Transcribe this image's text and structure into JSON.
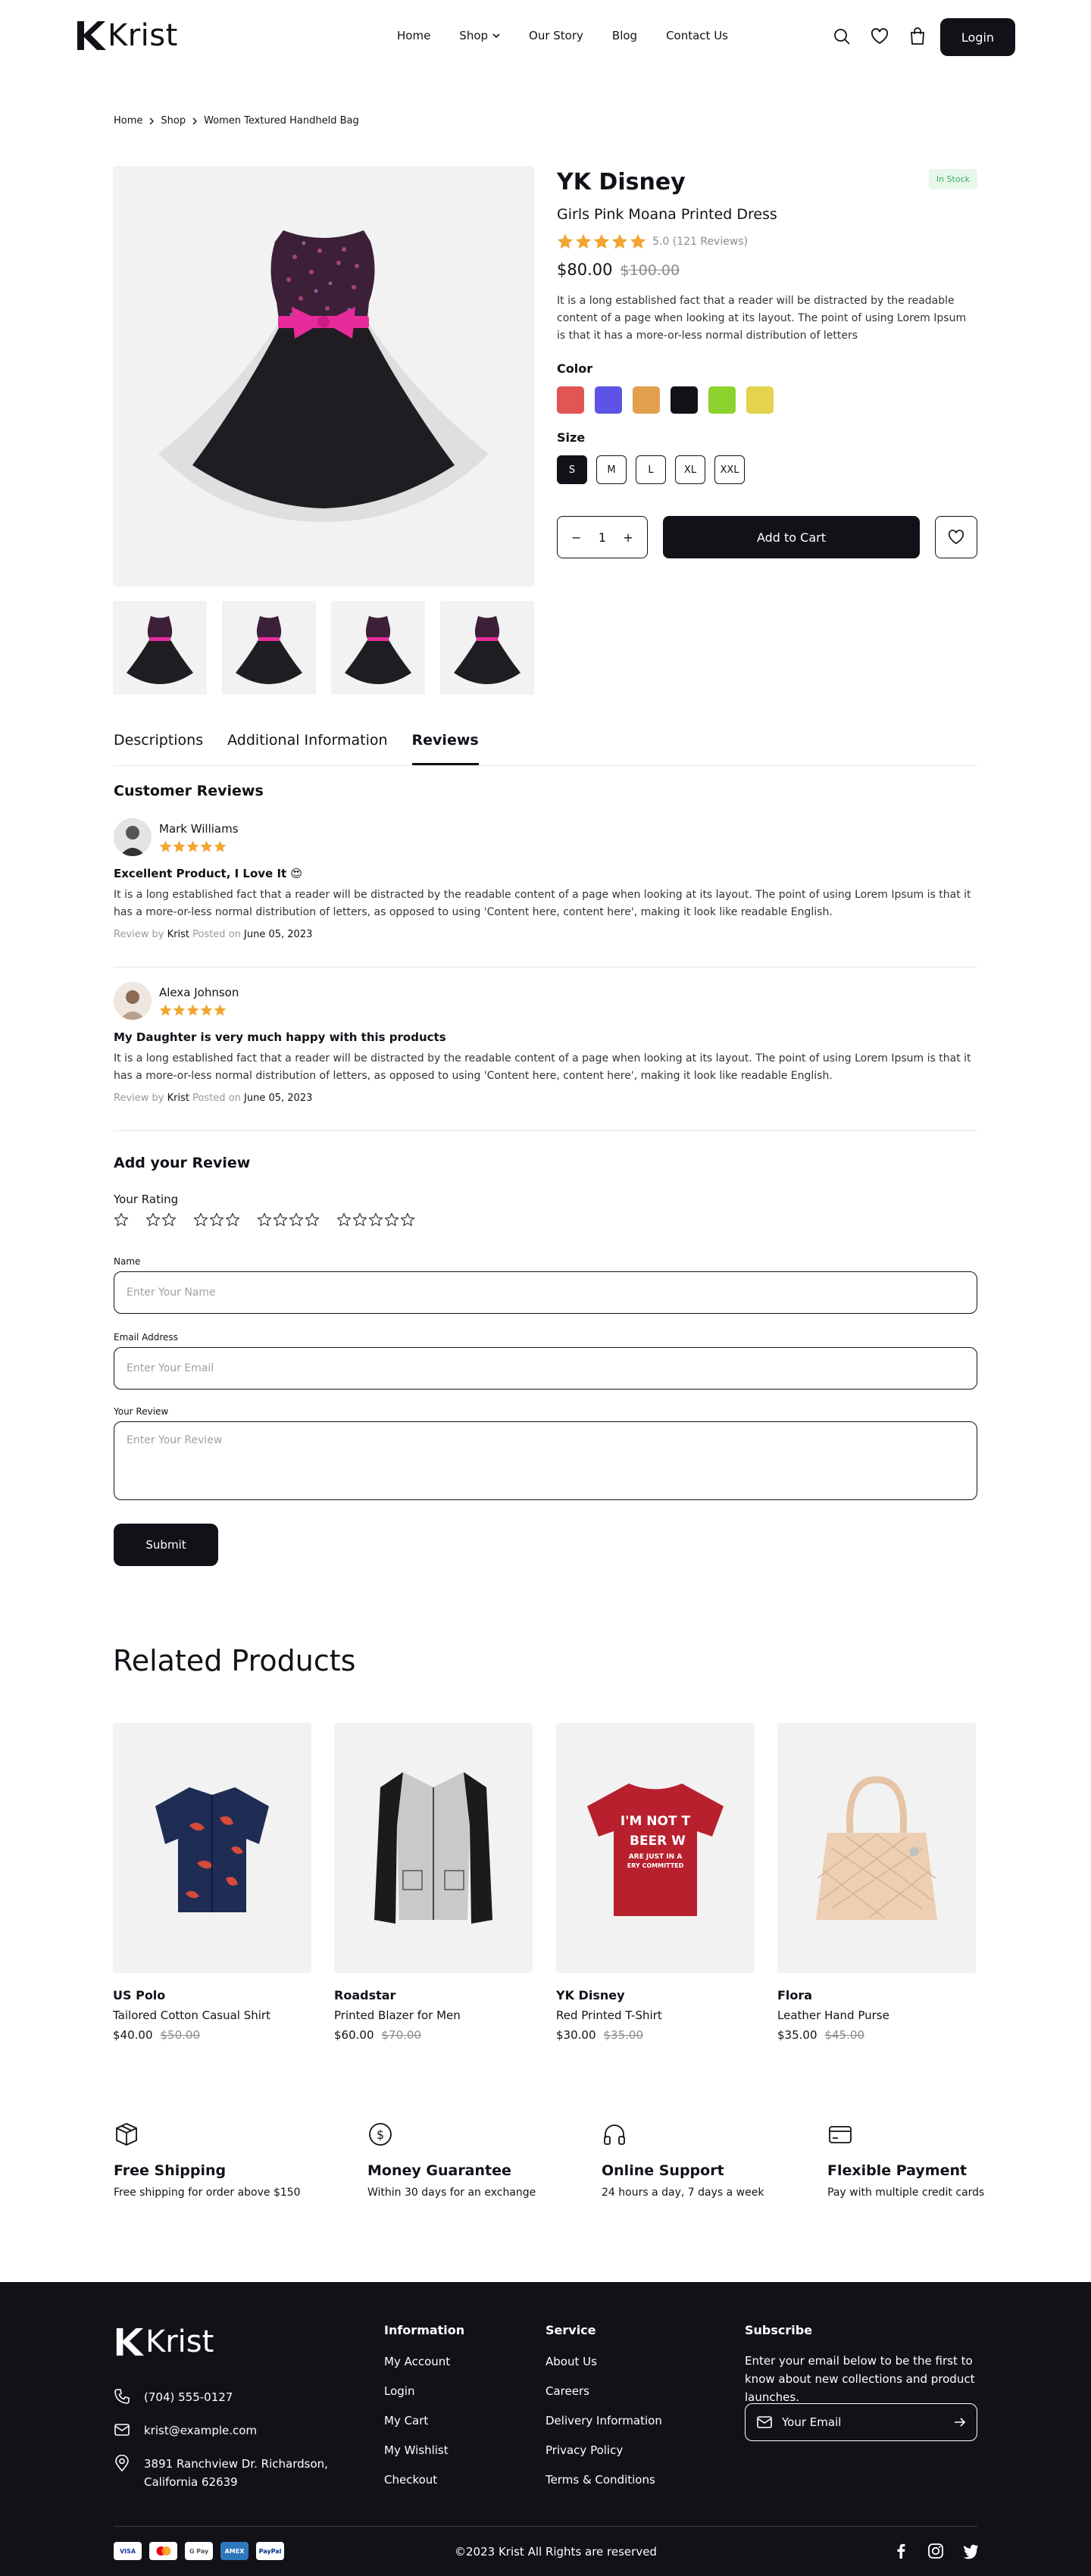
{
  "header": {
    "brand": "Krist",
    "nav": [
      {
        "label": "Home"
      },
      {
        "label": "Shop"
      },
      {
        "label": "Our Story"
      },
      {
        "label": "Blog"
      },
      {
        "label": "Contact Us"
      }
    ],
    "login": "Login"
  },
  "breadcrumb": [
    "Home",
    "Shop",
    "Women Textured Handheld Bag"
  ],
  "product": {
    "stock": "In Stock",
    "title": "YK Disney",
    "subtitle": "Girls Pink Moana Printed Dress",
    "rating": 5,
    "rating_text": "5.0 (121 Reviews)",
    "price": "$80.00",
    "old_price": "$100.00",
    "description": "It is a long established fact that a reader will be distracted by the readable content of a page when looking at its layout. The point of using Lorem Ipsum is that it has a more-or-less normal distribution of letters",
    "color_label": "Color",
    "colors": [
      "#e35454",
      "#5d53e6",
      "#e2a04f",
      "#131118",
      "#8dd32f",
      "#e3d34f"
    ],
    "size_label": "Size",
    "sizes": [
      "S",
      "M",
      "L",
      "XL",
      "XXL"
    ],
    "selected_size": "S",
    "quantity": "1",
    "add_to_cart": "Add to Cart"
  },
  "tabs": [
    "Descriptions",
    "Additional Information",
    "Reviews"
  ],
  "active_tab": "Reviews",
  "reviews": {
    "heading": "Customer Reviews",
    "items": [
      {
        "name": "Mark Williams",
        "rating": 5,
        "title": "Excellent Product, I Love It 😍",
        "body": "It is a long established fact that a reader will be distracted by the readable content of a page when looking at its layout. The point of using Lorem Ipsum is that it has a more-or-less normal distribution of letters, as opposed to using 'Content here, content here', making it look like readable English.",
        "review_by": "Review by",
        "author": "Krist",
        "posted_on": "Posted on",
        "date": "June 05, 2023"
      },
      {
        "name": "Alexa Johnson",
        "rating": 5,
        "title": "My Daughter is very much happy with this products",
        "body": "It is a long established fact that a reader will be distracted by the readable content of a page when looking at its layout. The point of using Lorem Ipsum is that it has a more-or-less normal distribution of letters, as opposed to using 'Content here, content here', making it look like readable English.",
        "review_by": "Review by",
        "author": "Krist",
        "posted_on": "Posted on",
        "date": "June 05, 2023"
      }
    ]
  },
  "add_review": {
    "heading": "Add your Review",
    "rating_label": "Your Rating",
    "name_label": "Name",
    "name_placeholder": "Enter Your Name",
    "email_label": "Email Address",
    "email_placeholder": "Enter Your Email",
    "review_label": "Your Review",
    "review_placeholder": "Enter Your Review",
    "submit": "Submit"
  },
  "related": {
    "heading": "Related Products",
    "items": [
      {
        "brand": "US Polo",
        "name": "Tailored Cotton Casual Shirt",
        "price": "$40.00",
        "old_price": "$50.00"
      },
      {
        "brand": "Roadstar",
        "name": "Printed Blazer for Men",
        "price": "$60.00",
        "old_price": "$70.00"
      },
      {
        "brand": "YK Disney",
        "name": "Red Printed T-Shirt",
        "price": "$30.00",
        "old_price": "$35.00",
        "print": "I'M NOT TO BEER WE ARE JUST IN A VERY COMMITTED"
      },
      {
        "brand": "Flora",
        "name": "Leather Hand Purse",
        "price": "$35.00",
        "old_price": "$45.00"
      }
    ]
  },
  "features": [
    {
      "title": "Free Shipping",
      "desc": "Free shipping for order above $150",
      "icon": "package-icon"
    },
    {
      "title": "Money Guarantee",
      "desc": "Within 30 days for an exchange",
      "icon": "dollar-icon"
    },
    {
      "title": "Online Support",
      "desc": "24 hours a day, 7 days a week",
      "icon": "headphones-icon"
    },
    {
      "title": "Flexible Payment",
      "desc": "Pay with multiple credit cards",
      "icon": "credit-card-icon"
    }
  ],
  "footer": {
    "brand": "Krist",
    "phone": "(704) 555-0127",
    "email": "krist@example.com",
    "address_line1": "3891 Ranchview Dr. Richardson,",
    "address_line2": "California 62639",
    "information": {
      "heading": "Information",
      "links": [
        "My Account",
        "Login",
        "My Cart",
        "My Wishlist",
        "Checkout"
      ]
    },
    "service": {
      "heading": "Service",
      "links": [
        "About Us",
        "Careers",
        "Delivery Information",
        "Privacy Policy",
        "Terms & Conditions"
      ]
    },
    "subscribe": {
      "heading": "Subscribe",
      "text": "Enter your email below to be the first to know about new collections and product launches.",
      "placeholder": "Your Email"
    },
    "payments": [
      "VISA",
      "Mastercard",
      "G Pay",
      "AMEX",
      "PayPal"
    ],
    "copyright": "©2023 Krist All Rights are reserved"
  }
}
